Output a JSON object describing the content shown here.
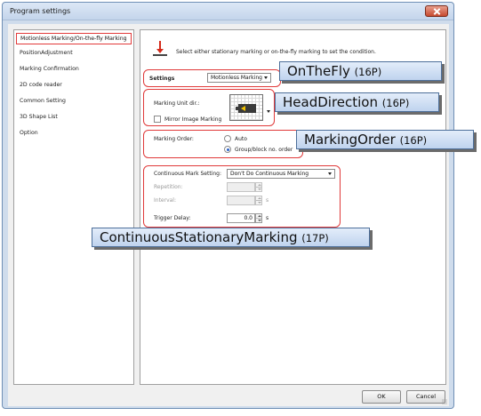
{
  "window": {
    "title": "Program settings"
  },
  "sidebar": {
    "items": [
      {
        "label": "Motionless Marking/On-the-fly Marking",
        "selected": true
      },
      {
        "label": "PositionAdjustment"
      },
      {
        "label": "Marking Confirmation"
      },
      {
        "label": "2D code reader"
      },
      {
        "label": "Common Setting"
      },
      {
        "label": "3D Shape List"
      },
      {
        "label": "Option"
      }
    ]
  },
  "panel": {
    "hint": "Select either stationary marking or on-the-fly marking to set the condition.",
    "settings": {
      "label": "Settings",
      "value": "Motionless Marking"
    },
    "marking_unit_dir": {
      "label": "Marking Unit dir.:"
    },
    "mirror_image": {
      "label": "Mirror Image Marking",
      "checked": false
    },
    "marking_order": {
      "label": "Marking Order:",
      "options": [
        {
          "label": "Auto",
          "checked": false
        },
        {
          "label": "Group/block no. order",
          "checked": true
        }
      ]
    },
    "continuous": {
      "label": "Continuous Mark Setting:",
      "value": "Don't Do Continuous Marking",
      "repetition_label": "Repetition:",
      "interval_label": "Interval:",
      "interval_unit": "s",
      "trigger_label": "Trigger Delay:",
      "trigger_value": "0.0",
      "trigger_unit": "s"
    }
  },
  "buttons": {
    "ok": "OK",
    "cancel": "Cancel"
  },
  "callouts": [
    {
      "name": "OnTheFly",
      "page": "(16P)"
    },
    {
      "name": "HeadDirection",
      "page": "(16P)"
    },
    {
      "name": "MarkingOrder",
      "page": "(16P)"
    },
    {
      "name": "ContinuousStationaryMarking",
      "page": "(17P)"
    }
  ],
  "colors": {
    "highlight_border": "#e03a3a",
    "callout_fill": "#cfdff3",
    "title_bar": "#c4d5eb"
  }
}
